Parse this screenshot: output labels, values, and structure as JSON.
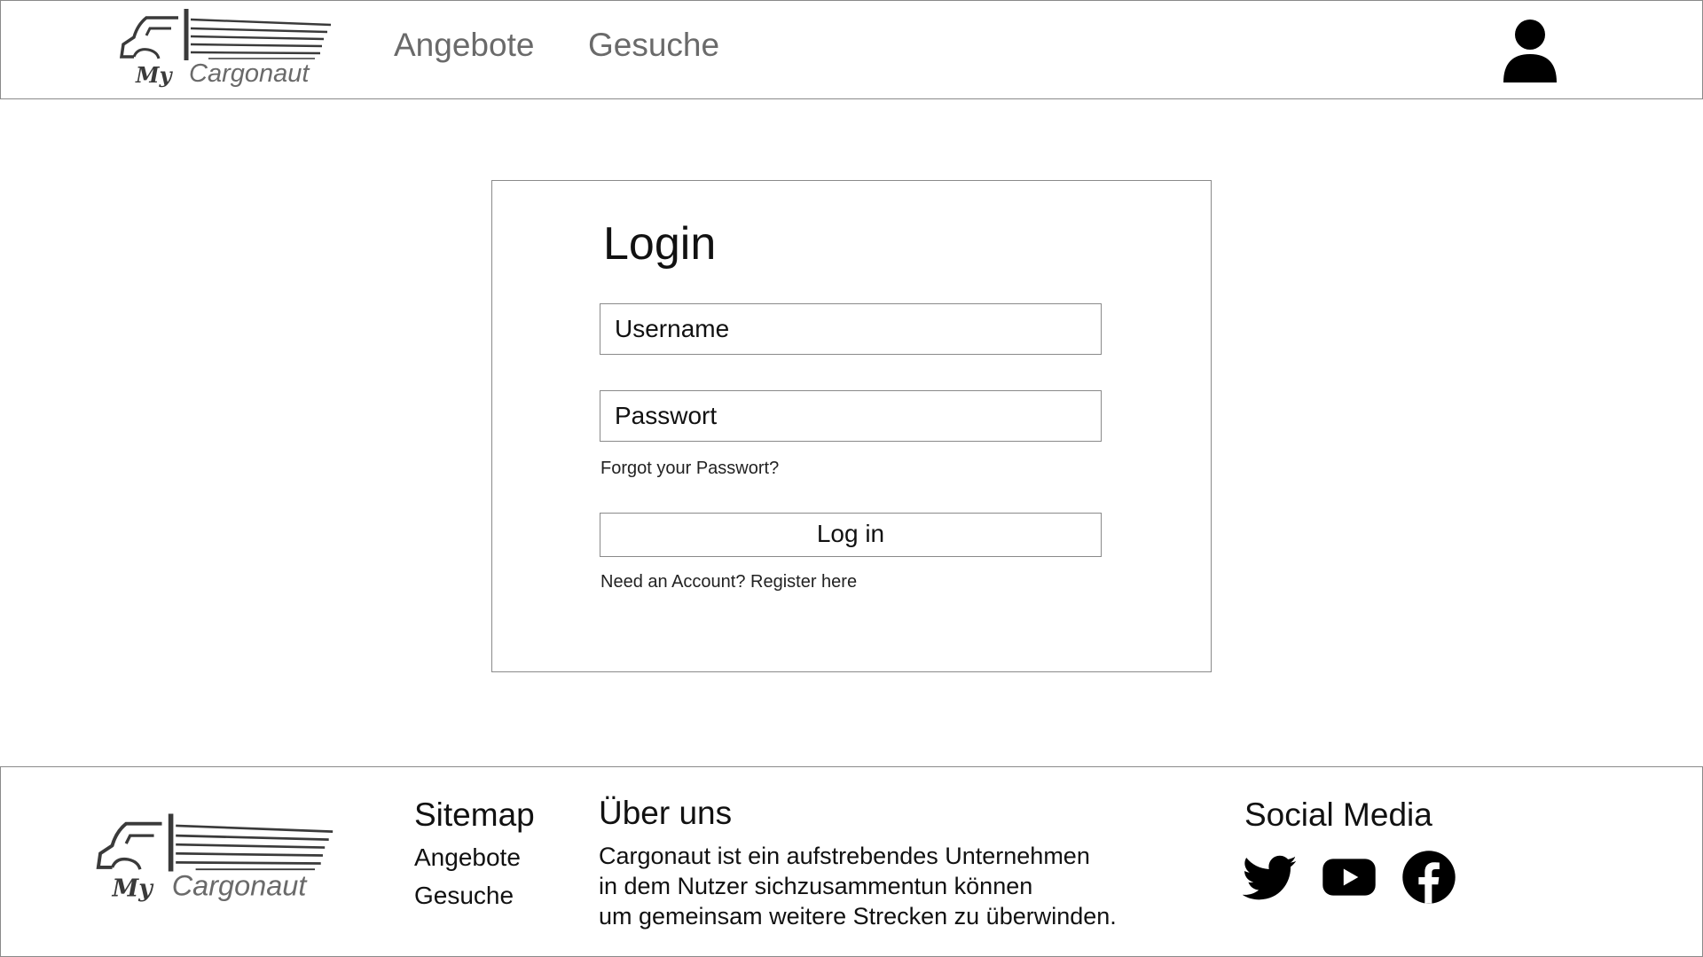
{
  "header": {
    "logo": {
      "my": "My",
      "brand": "Cargonaut"
    },
    "nav": [
      {
        "label": "Angebote"
      },
      {
        "label": "Gesuche"
      }
    ],
    "user_icon": "user-icon"
  },
  "login": {
    "title": "Login",
    "username": {
      "placeholder": "Username",
      "value": ""
    },
    "password": {
      "placeholder": "Passwort",
      "value": ""
    },
    "forgot_link": "Forgot your Passwort?",
    "submit_label": "Log in",
    "register_link": "Need an Account? Register here"
  },
  "footer": {
    "logo": {
      "my": "My",
      "brand": "Cargonaut"
    },
    "sitemap": {
      "heading": "Sitemap",
      "links": [
        {
          "label": "Angebote"
        },
        {
          "label": "Gesuche"
        }
      ]
    },
    "about": {
      "heading": "Über uns",
      "lines": [
        "Cargonaut ist ein aufstrebendes Unternehmen",
        "in dem Nutzer sichzusammentun können",
        "um gemeinsam weitere Strecken zu überwinden."
      ]
    },
    "social": {
      "heading": "Social Media",
      "icons": [
        "twitter-icon",
        "youtube-icon",
        "facebook-icon"
      ]
    }
  },
  "colors": {
    "border": "#8a8a8a",
    "nav_text": "#6a6a6a",
    "text": "#111111",
    "logo": "#3a3a3a"
  }
}
